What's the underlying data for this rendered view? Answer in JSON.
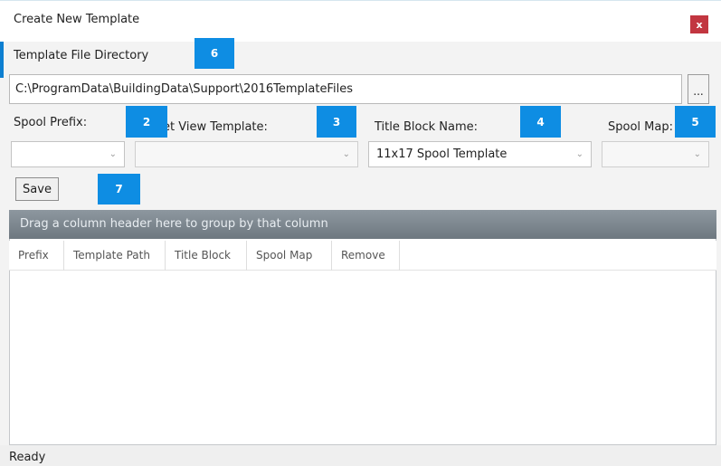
{
  "window": {
    "title": "Create New Template",
    "close_label": "x"
  },
  "template_directory": {
    "label": "Template File Directory",
    "path": "C:\\ProgramData\\BuildingData\\Support\\2016TemplateFiles",
    "browse_label": "..."
  },
  "fields": {
    "spool_prefix": {
      "label": "Spool Prefix:",
      "value": ""
    },
    "sheet_view_template": {
      "label": "et View Template:",
      "value": ""
    },
    "title_block_name": {
      "label": "Title Block Name:",
      "value": "11x17 Spool Template"
    },
    "spool_map": {
      "label": "Spool Map:",
      "value": ""
    }
  },
  "callouts": [
    "2",
    "3",
    "4",
    "5",
    "6",
    "7"
  ],
  "save_label": "Save",
  "grid": {
    "group_panel_text": "Drag a column header here to group by that column",
    "columns": [
      "Prefix",
      "Template Path",
      "Title Block",
      "Spool Map",
      "Remove"
    ]
  },
  "status": "Ready",
  "icons": {
    "chevron": "chevron-down-icon",
    "close": "close-icon"
  },
  "colors": {
    "callout": "#0e8de3",
    "close": "#c23640",
    "group_panel": "#78828a"
  }
}
